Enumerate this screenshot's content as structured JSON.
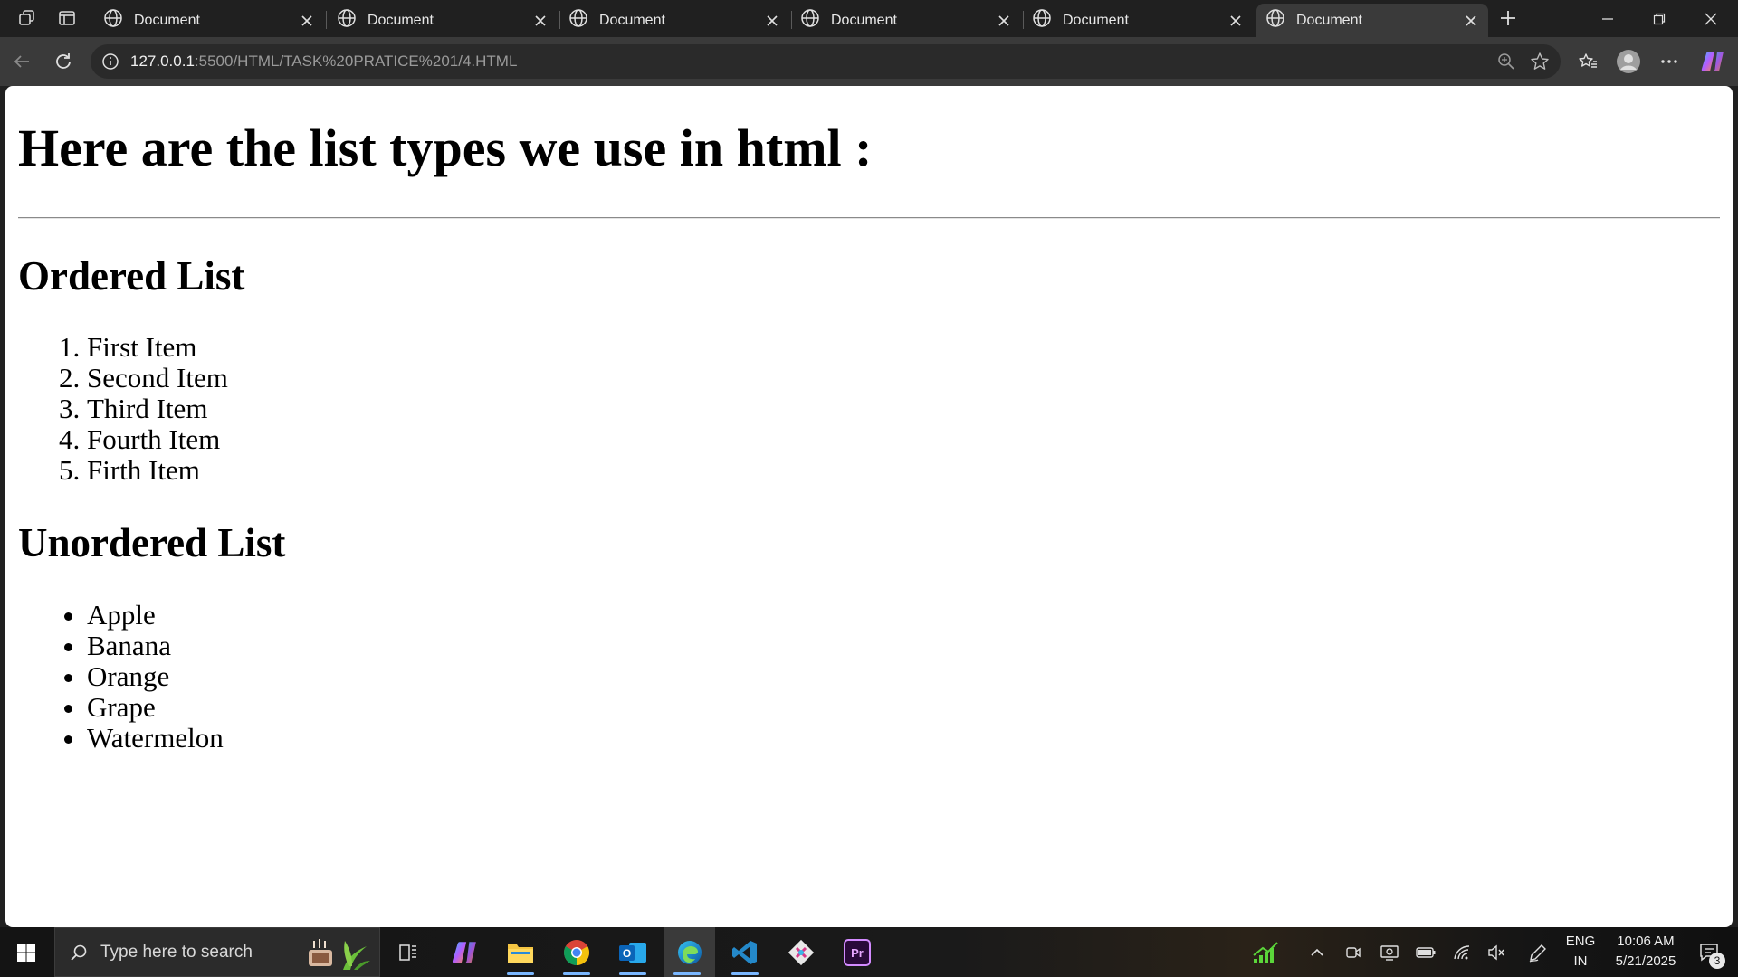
{
  "browser": {
    "tabs": [
      {
        "title": "Document",
        "active": false
      },
      {
        "title": "Document",
        "active": false
      },
      {
        "title": "Document",
        "active": false
      },
      {
        "title": "Document",
        "active": false
      },
      {
        "title": "Document",
        "active": false
      },
      {
        "title": "Document",
        "active": true
      }
    ],
    "url_host": "127.0.0.1",
    "url_path": ":5500/HTML/TASK%20PRATICE%201/4.HTML"
  },
  "page": {
    "heading": "Here are the list types we use in html :",
    "ordered_title": "Ordered List",
    "ordered_items": [
      "First Item",
      "Second Item",
      "Third Item",
      "Fourth Item",
      "Firth Item"
    ],
    "unordered_title": "Unordered List",
    "unordered_items": [
      "Apple",
      "Banana",
      "Orange",
      "Grape",
      "Watermelon"
    ]
  },
  "taskbar": {
    "search_placeholder": "Type here to search",
    "language": "ENG",
    "region": "IN",
    "time": "10:06 AM",
    "date": "5/21/2025",
    "notification_count": "3"
  },
  "colors": {
    "accent": "#7ab7ff",
    "tab_active": "#3a3a3a",
    "chrome_dark": "#202020"
  }
}
